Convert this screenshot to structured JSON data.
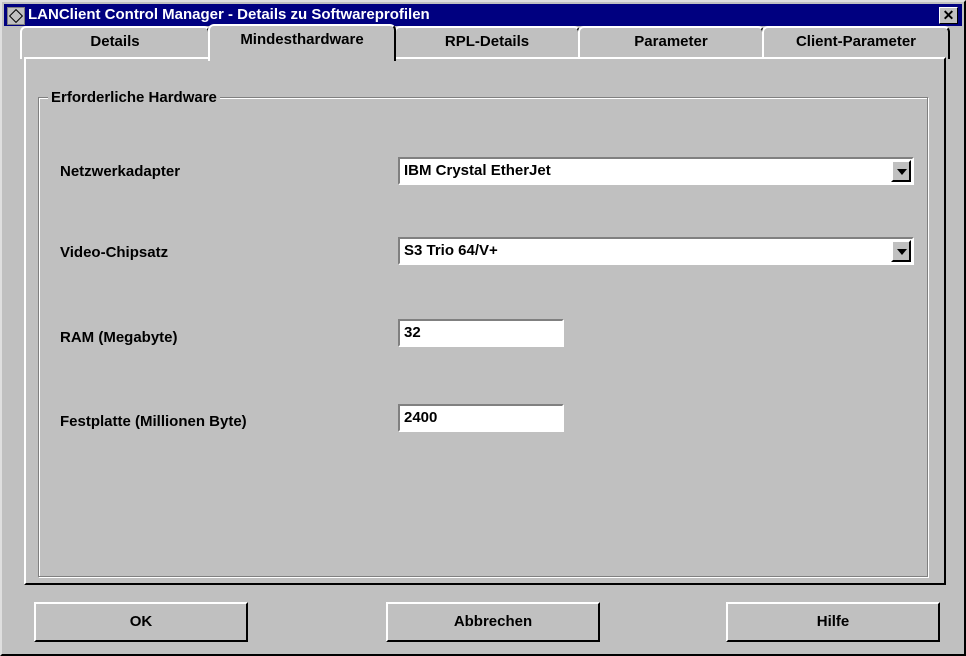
{
  "window": {
    "title": "LANClient Control Manager - Details zu Softwareprofilen",
    "close_label": "✕"
  },
  "tabs": [
    {
      "label": "Details",
      "active": false
    },
    {
      "label": "Mindesthardware",
      "active": true
    },
    {
      "label": "RPL-Details",
      "active": false
    },
    {
      "label": "Parameter",
      "active": false
    },
    {
      "label": "Client-Parameter",
      "active": false
    }
  ],
  "group": {
    "title": "Erforderliche Hardware",
    "fields": [
      {
        "label": "Netzwerkadapter",
        "value": "IBM Crystal EtherJet",
        "type": "combo"
      },
      {
        "label": "Video-Chipsatz",
        "value": "S3 Trio 64/V+",
        "type": "combo"
      },
      {
        "label": "RAM (Megabyte)",
        "value": "32",
        "type": "text"
      },
      {
        "label": "Festplatte (Millionen Byte)",
        "value": "2400",
        "type": "text"
      }
    ]
  },
  "buttons": {
    "ok": "OK",
    "cancel": "Abbrechen",
    "help": "Hilfe"
  }
}
